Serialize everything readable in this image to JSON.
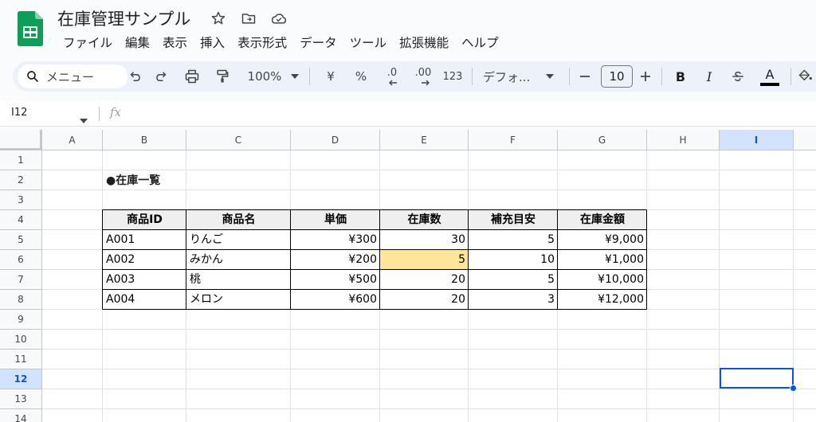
{
  "document": {
    "title": "在庫管理サンプル"
  },
  "menu": [
    "ファイル",
    "編集",
    "表示",
    "挿入",
    "表示形式",
    "データ",
    "ツール",
    "拡張機能",
    "ヘルプ"
  ],
  "toolbar": {
    "search_label": "メニュー",
    "zoom": "100%",
    "currency": "¥",
    "percent": "%",
    "decrease_decimal": ".0",
    "increase_decimal": ".00",
    "number_format": "123",
    "font": "デフォ...",
    "font_size": "10",
    "bold": "B",
    "italic": "I",
    "text_color": "A"
  },
  "formula_bar": {
    "name_box": "I12",
    "fx": "fx",
    "formula": ""
  },
  "grid": {
    "columns": [
      "A",
      "B",
      "C",
      "D",
      "E",
      "F",
      "G",
      "H",
      "I"
    ],
    "rows": [
      "1",
      "2",
      "3",
      "4",
      "5",
      "6",
      "7",
      "8",
      "9",
      "10",
      "11",
      "12",
      "13",
      "14"
    ],
    "selected_column": "I",
    "selected_row": "12",
    "heading": "●在庫一覧",
    "table_headers": [
      "商品ID",
      "商品名",
      "単価",
      "在庫数",
      "補充目安",
      "在庫金額"
    ],
    "table_rows": [
      [
        "A001",
        "りんご",
        "¥300",
        "30",
        "5",
        "¥9,000"
      ],
      [
        "A002",
        "みかん",
        "¥200",
        "5",
        "10",
        "¥1,000"
      ],
      [
        "A003",
        "桃",
        "¥500",
        "20",
        "5",
        "¥10,000"
      ],
      [
        "A004",
        "メロン",
        "¥600",
        "20",
        "3",
        "¥12,000"
      ]
    ],
    "highlight_color": "#ffe599"
  },
  "colors": {
    "accent": "#0b57d0",
    "sheets_green": "#0f9d58"
  }
}
